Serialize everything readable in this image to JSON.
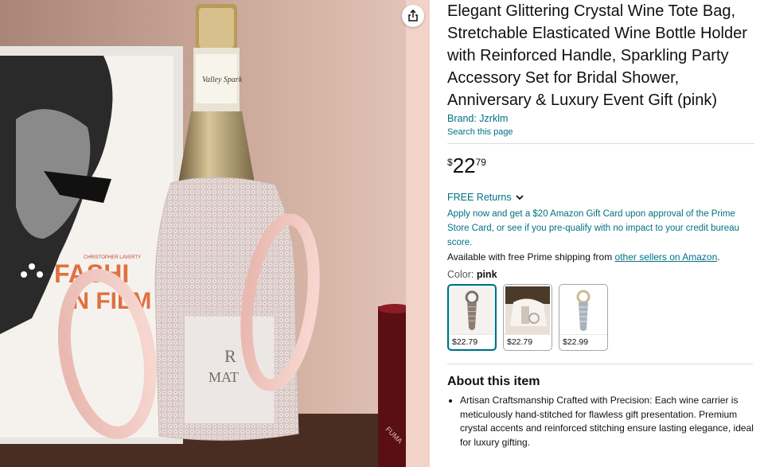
{
  "product": {
    "title": "Elegant Glittering Crystal Wine Tote Bag, Stretchable Elasticated Wine Bottle Holder with Reinforced Handle, Sparkling Party Accessory Set for Bridal Shower, Anniversary & Luxury Event Gift (pink)",
    "brand_label": "Brand: Jzrklm",
    "search_link": "Search this page",
    "price": {
      "symbol": "$",
      "whole": "22",
      "fraction": "79"
    },
    "returns_label": "FREE Returns",
    "promo_text": "Apply now and get a $20 Amazon Gift Card upon approval of the Prime Store Card, or see if you pre-qualify with no impact to your credit bureau score.",
    "shipping_prefix": "Available with free Prime shipping from ",
    "shipping_link": "other sellers on Amazon",
    "shipping_suffix": ".",
    "color_label": "Color: ",
    "color_value": "pink",
    "swatches": [
      {
        "price": "$22.79",
        "selected": true
      },
      {
        "price": "$22.79",
        "selected": false
      },
      {
        "price": "$22.99",
        "selected": false
      }
    ],
    "about_heading": "About this item",
    "bullets": [
      "Artisan Craftsmanship Crafted with Precision: Each wine carrier is meticulously hand-stitched for flawless gift presentation. Premium crystal accents and reinforced stitching ensure lasting elegance, ideal for luxury gifting."
    ]
  },
  "image": {
    "book_text_line1": "FASHI",
    "book_text_line2": "IN FILM",
    "book_author": "CHRISTOPHER LAVERTY",
    "label_text1": "R",
    "label_text2": "MAT",
    "candle_text": "FUMA",
    "bottle_label_text": "Valley Spark",
    "icons": [
      "share-icon",
      "chevron-down-icon"
    ]
  },
  "colors": {
    "link": "#007185",
    "text": "#0f1111",
    "muted": "#565959",
    "selected_border": "#007185"
  }
}
